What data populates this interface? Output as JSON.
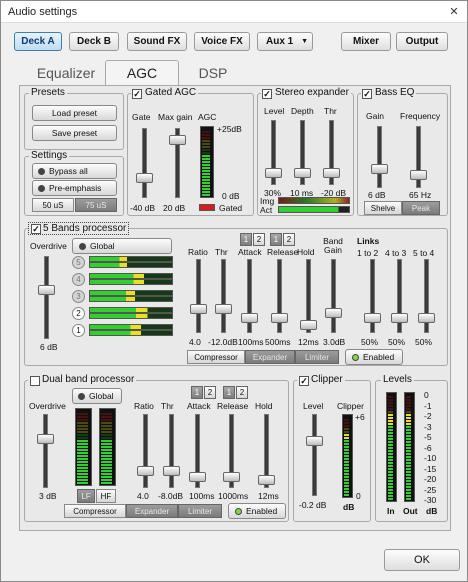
{
  "window": {
    "title": "Audio settings",
    "close": "✕"
  },
  "toolbar": {
    "deck_a": "Deck A",
    "deck_b": "Deck B",
    "sound_fx": "Sound FX",
    "voice_fx": "Voice FX",
    "aux": "Aux 1",
    "aux_arrow": "▼",
    "mixer": "Mixer",
    "output": "Output"
  },
  "tabs": {
    "equalizer": "Equalizer",
    "agc": "AGC",
    "dsp": "DSP"
  },
  "presets": {
    "title": "Presets",
    "load": "Load preset",
    "save": "Save preset"
  },
  "settings": {
    "title": "Settings",
    "bypass": "Bypass all",
    "preemph": "Pre-emphasis",
    "us50": "50 uS",
    "us75": "75 uS"
  },
  "gated_agc": {
    "title": "Gated AGC",
    "check": "✓",
    "gate": "Gate",
    "max_gain": "Max gain",
    "agc": "AGC",
    "top": "+25dB",
    "zero": "0 dB",
    "gate_val": "-40 dB",
    "max_val": "20 dB",
    "gated": "Gated",
    "gate_pos": 0.75,
    "max_pos": 0.12,
    "agc_level": 0.62
  },
  "stereo": {
    "title": "Stereo expander",
    "check": "✓",
    "level": "Level",
    "depth": "Depth",
    "thr": "Thr",
    "level_val": "30%",
    "depth_val": "10 ms",
    "thr_val": "-20 dB",
    "img": "Img",
    "act": "Act",
    "level_pos": 0.88,
    "depth_pos": 0.88,
    "thr_pos": 0.88
  },
  "bass": {
    "title": "Bass EQ",
    "check": "✓",
    "gain": "Gain",
    "freq": "Frequency",
    "gain_val": "6 dB",
    "freq_val": "65 Hz",
    "shelve": "Shelve",
    "peak": "Peak",
    "gain_pos": 0.74,
    "freq_pos": 0.84
  },
  "five_band": {
    "title": "5 Bands processor",
    "check": "✓",
    "overdrive": "Overdrive",
    "global": "Global",
    "overdrive_val": "6 dB",
    "ratio": "Ratio",
    "thr": "Thr",
    "attack": "Attack",
    "release": "Release",
    "hold": "Hold",
    "band_gain": "Band Gain",
    "links": "Links",
    "l12": "1 to 2",
    "l43": "4 to 3",
    "l54": "5 to 4",
    "ratio_val": "4.0",
    "thr_val": "-12.0dB",
    "attack_val": "100ms",
    "release_val": "500ms",
    "hold_val": "12ms",
    "gain_val": "3.0dB",
    "link1_val": "50%",
    "link2_val": "50%",
    "link3_val": "50%",
    "sel1": "1",
    "sel2": "2",
    "bands": [
      "5",
      "4",
      "3",
      "2",
      "1"
    ],
    "compressor": "Compressor",
    "expander": "Expander",
    "limiter": "Limiter",
    "enabled": "Enabled",
    "band_levels": [
      0.45,
      0.66,
      0.55,
      0.7,
      0.62
    ]
  },
  "dual": {
    "title": "Dual band processor",
    "overdrive": "Overdrive",
    "global": "Global",
    "overdrive_val": "3 dB",
    "lf": "LF",
    "hf": "HF",
    "ratio": "Ratio",
    "thr": "Thr",
    "attack": "Attack",
    "release": "Release",
    "hold": "Hold",
    "ratio_val": "4.0",
    "thr_val": "-8.0dB",
    "attack_val": "100ms",
    "release_val": "1000ms",
    "hold_val": "12ms",
    "sel1": "1",
    "sel2": "2",
    "compressor": "Compressor",
    "expander": "Expander",
    "limiter": "Limiter",
    "enabled": "Enabled",
    "lf_level": 0.62,
    "hf_level": 0.6
  },
  "clipper": {
    "title": "Clipper",
    "check": "✓",
    "level": "Level",
    "clipper": "Clipper",
    "level_val": "-0.2 dB",
    "top": "+6",
    "zero": "0",
    "db": "dB",
    "level_pos": 0.3,
    "clip_level": 0.8
  },
  "levels": {
    "title": "Levels",
    "in": "In",
    "out": "Out",
    "db": "dB",
    "ticks": [
      "0",
      "-1",
      "-2",
      "-3",
      "-5",
      "-6",
      "-10",
      "-15",
      "-20",
      "-25",
      "-30"
    ],
    "in_level": 0.82,
    "out_level": 0.82
  },
  "footer": {
    "ok": "OK"
  },
  "colors": {
    "accent": "#3c7fb1",
    "meter_green": "#2fd02f",
    "meter_yellow": "#e8e020",
    "meter_red": "#e02020",
    "led_green": "#7cdc3a"
  }
}
